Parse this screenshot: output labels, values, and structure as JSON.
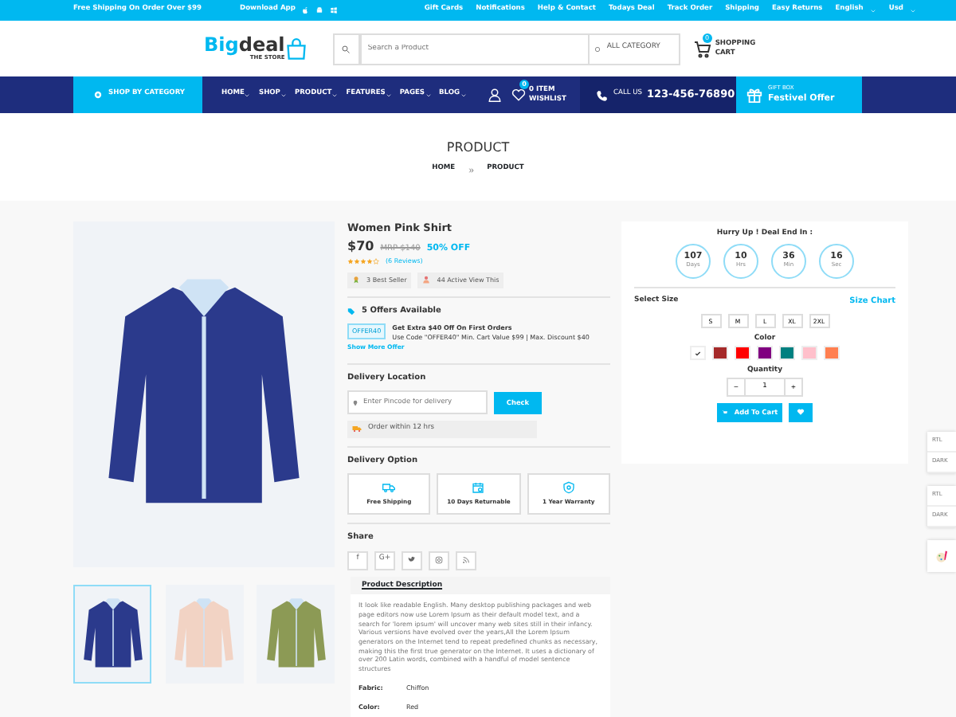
{
  "topbar": {
    "promo": "Free Shipping On Order Over $99",
    "download_label": "Download App",
    "links": [
      "Gift Cards",
      "Notifications",
      "Help & Contact",
      "Todays Deal",
      "Track Order",
      "Shipping",
      "Easy Returns"
    ],
    "language": "English",
    "currency": "Usd"
  },
  "header": {
    "logo": {
      "part_a": "Big",
      "part_b": "deal",
      "tagline": "THE STORE"
    },
    "search": {
      "placeholder": "Search a Product"
    },
    "category": "ALL CATEGORY",
    "cart": {
      "count": "0",
      "label": "SHOPPING CART"
    }
  },
  "nav": {
    "shop_by_category": "SHOP BY CATEGORY",
    "menu": [
      "HOME",
      "SHOP",
      "PRODUCT",
      "FEATURES",
      "PAGES",
      "BLOG"
    ],
    "wishlist": {
      "count": "0",
      "label": "0 ITEM WISHLIST"
    },
    "call": {
      "label": "CALL US",
      "number": "123-456-76890"
    },
    "gift": {
      "small": "GIFT BOX",
      "big": "Festivel Offer"
    }
  },
  "page_title": "PRODUCT",
  "breadcrumb": [
    "HOME",
    "PRODUCT"
  ],
  "gallery": {
    "thumbnails": [
      {
        "color": "#2b3a8c",
        "selected": true
      },
      {
        "color": "#f2d3c4",
        "selected": false
      },
      {
        "color": "#8c9a55",
        "selected": false
      }
    ]
  },
  "product": {
    "name": "Women Pink Shirt",
    "price": "$70",
    "mrp": "MRP $140",
    "discount": "50% OFF",
    "stars": 4,
    "reviews": "(6 Reviews)",
    "badges": [
      "3 Best Seller",
      "44 Active View This"
    ],
    "offers": {
      "title": "5 Offers Available",
      "code": "OFFER40",
      "headline": "Get Extra $40 Off On First Orders",
      "detail": "Use Code \"OFFER40\" Min. Cart Value $99 | Max. Discount $40",
      "more": "Show More Offer"
    },
    "delivery": {
      "title": "Delivery Location",
      "placeholder": "Enter Pincode for delivery",
      "button": "Check",
      "note": "Order within 12 hrs"
    },
    "delivery_option": {
      "title": "Delivery Option",
      "options": [
        {
          "kind": "truck",
          "label": "Free Shipping"
        },
        {
          "kind": "return",
          "label": "10 Days Returnable"
        },
        {
          "kind": "shield",
          "label": "1 Year Warranty"
        }
      ]
    },
    "share": {
      "title": "Share",
      "items": [
        {
          "kind": "text",
          "label": "f"
        },
        {
          "kind": "text",
          "label": "G+"
        },
        {
          "kind": "twitter"
        },
        {
          "kind": "instagram"
        },
        {
          "kind": "rss"
        }
      ]
    },
    "description": {
      "tab": "Product Description",
      "text": "It look like readable English. Many desktop publishing packages and web page editors now use Lorem Ipsum as their default model text, and a search for 'lorem ipsum' will uncover many web sites still in their infancy. Various versions have evolved over the years,All the Lorem Ipsum generators on the Internet tend to repeat predefined chunks as necessary, making this the first true generator on the Internet. It uses a dictionary of over 200 Latin words, combined with a handful of model sentence structures",
      "specs": [
        {
          "label": "Fabric:",
          "value": "Chiffon"
        },
        {
          "label": "Color:",
          "value": "Red"
        }
      ]
    }
  },
  "deal": {
    "title": "Hurry Up ! Deal End In :",
    "timers": [
      {
        "value": "107",
        "unit": "Days"
      },
      {
        "value": "10",
        "unit": "Hrs"
      },
      {
        "value": "36",
        "unit": "Min"
      },
      {
        "value": "16",
        "unit": "Sec"
      }
    ],
    "size_label": "Select Size",
    "size_chart": "Size Chart",
    "sizes": [
      {
        "label": "S",
        "selected": false
      },
      {
        "label": "M",
        "selected": false
      },
      {
        "label": "L",
        "selected": false
      },
      {
        "label": "XL",
        "selected": false
      },
      {
        "label": "2XL",
        "selected": false
      }
    ],
    "color_label": "Color",
    "colors": [
      {
        "color": "#ffffff",
        "selected": true
      },
      {
        "color": "#a52a2a",
        "selected": false
      },
      {
        "color": "#ff0000",
        "selected": false
      },
      {
        "color": "#800080",
        "selected": false
      },
      {
        "color": "#008080",
        "selected": false
      },
      {
        "color": "#ffc0cb",
        "selected": false
      },
      {
        "color": "#ff7f50",
        "selected": false
      }
    ],
    "quantity_label": "Quantity",
    "minus": "−",
    "quantity": "1",
    "plus": "+",
    "add_to_cart": "Add To Cart"
  },
  "side_tabs": [
    "RTL",
    "DARK",
    "RTL",
    "DARK"
  ]
}
